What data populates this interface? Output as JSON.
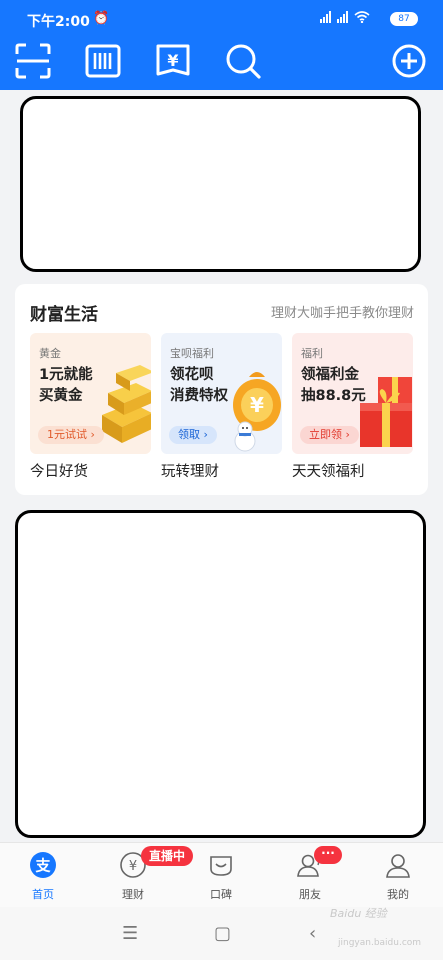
{
  "status_bar": {
    "time": "下午2:00",
    "battery": "87"
  },
  "toolbar": {
    "icons": [
      "scan-icon",
      "barcode-icon",
      "payment-code-icon",
      "search-icon",
      "add-icon"
    ]
  },
  "wealth": {
    "title": "财富生活",
    "subtitle": "理财大咖手把手教你理财",
    "tiles": [
      {
        "tag": "黄金",
        "line1": "1元就能",
        "line2": "买黄金",
        "button": "1元试试 ›",
        "caption": "今日好货"
      },
      {
        "tag": "宝呗福利",
        "line1": "领花呗",
        "line2": "消费特权",
        "button": "领取 ›",
        "caption": "玩转理财"
      },
      {
        "tag": "福利",
        "line1": "领福利金",
        "line2": "抽88.8元",
        "button": "立即领 ›",
        "caption": "天天领福利"
      }
    ]
  },
  "bottom_nav": {
    "items": [
      {
        "label": "首页"
      },
      {
        "label": "理财"
      },
      {
        "label": "口碑"
      },
      {
        "label": "朋友"
      },
      {
        "label": "我的"
      }
    ],
    "live_badge": "直播中",
    "friends_badge": "···"
  },
  "watermark": {
    "line1": "Baidu 经验",
    "line2": "jingyan.baidu.com"
  },
  "colors": {
    "brand_blue": "#1677ff",
    "badge_red": "#f5333f"
  }
}
